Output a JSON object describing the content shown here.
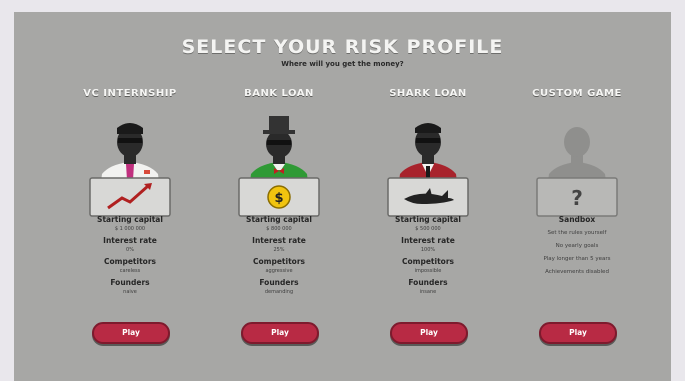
{
  "header": {
    "title": "SELECT YOUR RISK PROFILE",
    "subtitle": "Where will you get the money?"
  },
  "cards": [
    {
      "title": "VC INTERNSHIP",
      "stats": [
        {
          "label": "Starting capital",
          "value": "$ 1 000 000"
        },
        {
          "label": "Interest rate",
          "value": "0%"
        },
        {
          "label": "Competitors",
          "value": "careless"
        },
        {
          "label": "Founders",
          "value": "naive"
        }
      ],
      "play_label": "Play"
    },
    {
      "title": "BANK LOAN",
      "stats": [
        {
          "label": "Starting capital",
          "value": "$ 800 000"
        },
        {
          "label": "Interest rate",
          "value": "25%"
        },
        {
          "label": "Competitors",
          "value": "aggressive"
        },
        {
          "label": "Founders",
          "value": "demanding"
        }
      ],
      "play_label": "Play"
    },
    {
      "title": "SHARK LOAN",
      "stats": [
        {
          "label": "Starting capital",
          "value": "$ 500 000"
        },
        {
          "label": "Interest rate",
          "value": "100%"
        },
        {
          "label": "Competitors",
          "value": "impossible"
        },
        {
          "label": "Founders",
          "value": "insane"
        }
      ],
      "play_label": "Play"
    },
    {
      "title": "CUSTOM GAME",
      "sandbox_title": "Sandbox",
      "lines": [
        "Set the rules yourself",
        "No yearly goals",
        "Play longer than 5 years",
        "Achievements disabled"
      ],
      "play_label": "Play"
    }
  ],
  "colors": {
    "panel": "#a7a7a5",
    "play_button": "#b82a44",
    "vc_suit": "#f2f2f0",
    "bank_suit": "#2f9a35",
    "shark_suit": "#a8232c",
    "custom_silhouette": "#8f8f8d"
  },
  "icons": {
    "vc": "rising-arrow-icon",
    "bank": "dollar-coin-icon",
    "shark": "shark-icon",
    "custom": "question-mark-icon"
  }
}
